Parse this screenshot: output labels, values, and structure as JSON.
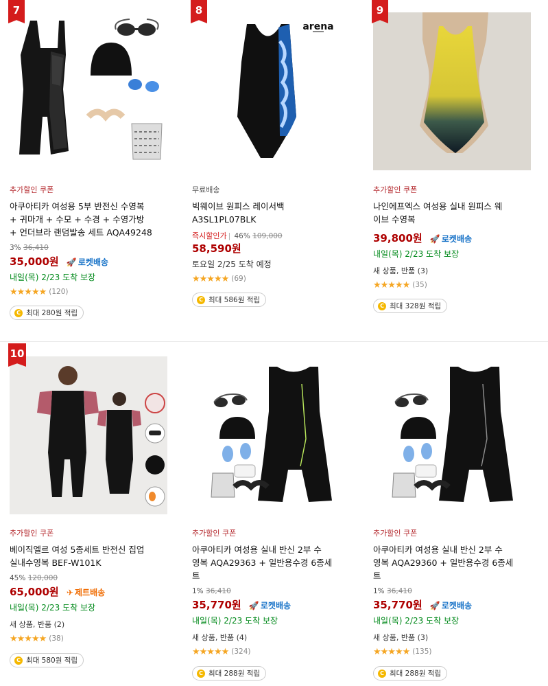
{
  "products": [
    {
      "rank": "7",
      "coupon": "추가할인 쿠폰",
      "title_lines": [
        "아쿠아티카 여성용 5부 반전신 수영복",
        "+ 귀마개 + 수모 + 수경 + 수영가방",
        "+ 언더브라 랜덤발송 세트 AQA49248"
      ],
      "discount": "3%",
      "original_price": "36,410",
      "price": "35,000원",
      "badge": "로켓배송",
      "delivery": "내일(목) 2/23 도착 보장",
      "star_rating": 4.5,
      "review_count": "(120)",
      "cash": "최대 280원 적립"
    },
    {
      "rank": "8",
      "free_shipping": "무료배송",
      "title_lines": [
        "빅웨이브 원피스 레이서백",
        "A3SL1PL07BLK"
      ],
      "instant_label": "즉시할인가",
      "discount": "46%",
      "original_price": "109,000",
      "price": "58,590원",
      "delivery": "토요일 2/25 도착 예정",
      "star_rating": 4.5,
      "review_count": "(69)",
      "cash": "최대 586원 적립"
    },
    {
      "rank": "9",
      "coupon": "추가할인 쿠폰",
      "title_lines": [
        "나인에프엑스 여성용 실내 원피스 웨",
        "이브 수영복"
      ],
      "price": "39,800원",
      "badge": "로켓배송",
      "delivery": "내일(목) 2/23 도착 보장",
      "used": "새 상품, 반품 (3)",
      "star_rating": 4.5,
      "review_count": "(35)",
      "cash": "최대 328원 적립"
    },
    {
      "rank": "10",
      "coupon": "추가할인 쿠폰",
      "title_lines": [
        "베이직엘르 여성 5종세트 반전신 집업",
        "실내수영복 BEF-W101K"
      ],
      "discount": "45%",
      "original_price": "120,000",
      "price": "65,000원",
      "badge": "제트배송",
      "delivery": "내일(목) 2/23 도착 보장",
      "used": "새 상품, 반품 (2)",
      "star_rating": 4.5,
      "review_count": "(38)",
      "cash": "최대 580원 적립"
    },
    {
      "coupon": "추가할인 쿠폰",
      "title_lines": [
        "아쿠아티카 여성용 실내 반신 2부 수",
        "영복 AQA29363 + 일반용수경 6종세",
        "트"
      ],
      "discount": "1%",
      "original_price": "36,410",
      "price": "35,770원",
      "badge": "로켓배송",
      "delivery": "내일(목) 2/23 도착 보장",
      "used": "새 상품, 반품 (4)",
      "star_rating": 4.5,
      "review_count": "(324)",
      "cash": "최대 288원 적립"
    },
    {
      "coupon": "추가할인 쿠폰",
      "title_lines": [
        "아쿠아티카 여성용 실내 반신 2부 수",
        "영복 AQA29360 + 일반용수경 6종세",
        "트"
      ],
      "discount": "1%",
      "original_price": "36,410",
      "price": "35,770원",
      "badge": "로켓배송",
      "delivery": "내일(목) 2/23 도착 보장",
      "used": "새 상품, 반품 (3)",
      "star_rating": 4.5,
      "review_count": "(135)",
      "cash": "최대 288원 적립"
    }
  ],
  "brand_logo_text": "arena",
  "colors": {
    "rank_badge": "#d41c1c",
    "price": "#ae0000",
    "rocket": "#1a74c8",
    "jet": "#f06b00",
    "delivery_green": "#00891a",
    "coupon_red": "#b4282d",
    "star": "#f5a623",
    "coin": "#f5b800"
  },
  "icons": {
    "rocket_badge": "rocket-icon",
    "jet_badge": "jet-icon",
    "cash_coin": "coin-icon",
    "rating": "star-icon"
  }
}
